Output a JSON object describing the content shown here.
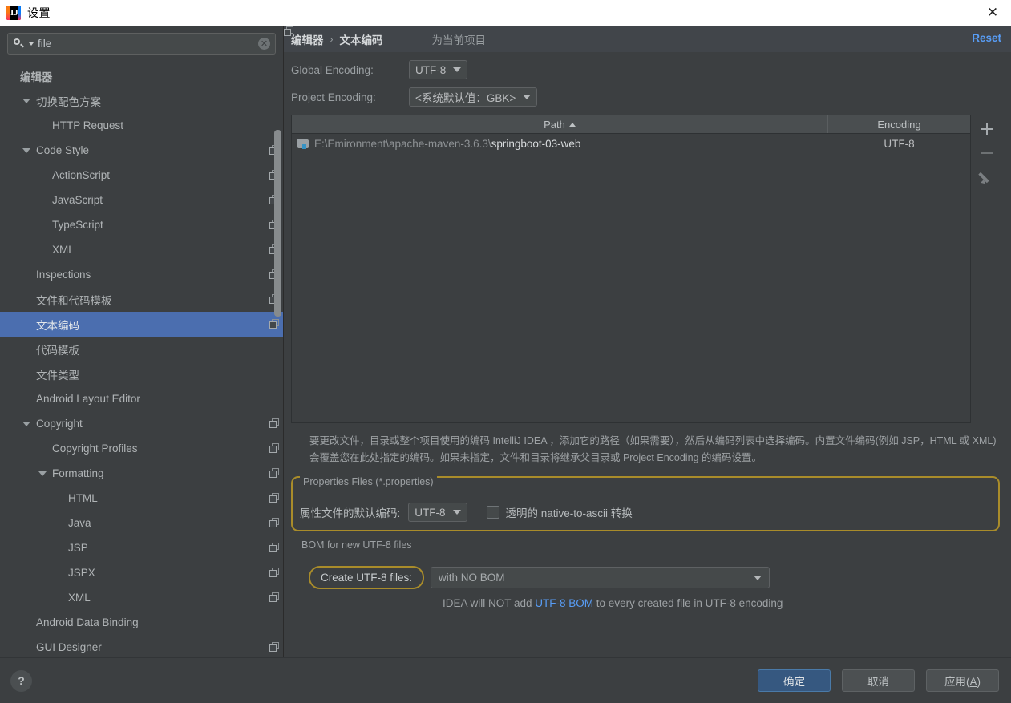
{
  "window": {
    "title": "设置",
    "app_icon": "intellij-idea-icon",
    "close_label": "✕"
  },
  "search": {
    "value": "file",
    "icon": "search-icon",
    "clear_icon": "clear-icon",
    "clear_glyph": "✕"
  },
  "sidebar": {
    "scrollbar": true,
    "items": [
      {
        "label": "编辑器",
        "indent": 0,
        "arrow": "none",
        "copy": false,
        "selected": false,
        "bold": true
      },
      {
        "label": "切换配色方案",
        "indent": 1,
        "arrow": "expanded",
        "copy": false,
        "selected": false
      },
      {
        "label": "HTTP Request",
        "indent": 2,
        "arrow": "none",
        "copy": false,
        "selected": false
      },
      {
        "label": "Code Style",
        "indent": 1,
        "arrow": "expanded",
        "copy": true,
        "selected": false
      },
      {
        "label": "ActionScript",
        "indent": 2,
        "arrow": "none",
        "copy": true,
        "selected": false
      },
      {
        "label": "JavaScript",
        "indent": 2,
        "arrow": "none",
        "copy": true,
        "selected": false
      },
      {
        "label": "TypeScript",
        "indent": 2,
        "arrow": "none",
        "copy": true,
        "selected": false
      },
      {
        "label": "XML",
        "indent": 2,
        "arrow": "none",
        "copy": true,
        "selected": false
      },
      {
        "label": "Inspections",
        "indent": 1,
        "arrow": "none",
        "copy": true,
        "selected": false
      },
      {
        "label": "文件和代码模板",
        "indent": 1,
        "arrow": "none",
        "copy": true,
        "selected": false
      },
      {
        "label": "文本编码",
        "indent": 1,
        "arrow": "none",
        "copy": true,
        "selected": true
      },
      {
        "label": "代码模板",
        "indent": 1,
        "arrow": "none",
        "copy": false,
        "selected": false
      },
      {
        "label": "文件类型",
        "indent": 1,
        "arrow": "none",
        "copy": false,
        "selected": false
      },
      {
        "label": "Android Layout Editor",
        "indent": 1,
        "arrow": "none",
        "copy": false,
        "selected": false
      },
      {
        "label": "Copyright",
        "indent": 1,
        "arrow": "expanded",
        "copy": true,
        "selected": false
      },
      {
        "label": "Copyright Profiles",
        "indent": 2,
        "arrow": "none",
        "copy": true,
        "selected": false
      },
      {
        "label": "Formatting",
        "indent": 2,
        "arrow": "expanded",
        "copy": true,
        "selected": false
      },
      {
        "label": "HTML",
        "indent": 3,
        "arrow": "none",
        "copy": true,
        "selected": false
      },
      {
        "label": "Java",
        "indent": 3,
        "arrow": "none",
        "copy": true,
        "selected": false
      },
      {
        "label": "JSP",
        "indent": 3,
        "arrow": "none",
        "copy": true,
        "selected": false
      },
      {
        "label": "JSPX",
        "indent": 3,
        "arrow": "none",
        "copy": true,
        "selected": false
      },
      {
        "label": "XML",
        "indent": 3,
        "arrow": "none",
        "copy": true,
        "selected": false
      },
      {
        "label": "Android Data Binding",
        "indent": 1,
        "arrow": "none",
        "copy": false,
        "selected": false
      },
      {
        "label": "GUI Designer",
        "indent": 1,
        "arrow": "none",
        "copy": true,
        "selected": false
      }
    ]
  },
  "panel": {
    "breadcrumb": {
      "parent": "编辑器",
      "separator": "›",
      "current": "文本编码"
    },
    "scope_link": "为当前项目",
    "scope_icon": "copy-icon",
    "reset_label": "Reset",
    "global_encoding": {
      "label": "Global Encoding:",
      "value": "UTF-8"
    },
    "project_encoding": {
      "label": "Project Encoding:",
      "value": "<系统默认值：GBK>"
    },
    "table": {
      "columns": [
        "Path",
        "Encoding"
      ],
      "sort_column": "Path",
      "sort_direction": "asc",
      "rows": [
        {
          "path_prefix": "E:\\Emironment\\apache-maven-3.6.3\\",
          "path_name": "springboot-03-web",
          "encoding": "UTF-8"
        }
      ],
      "tools": [
        "add-icon",
        "remove-icon",
        "edit-icon"
      ]
    },
    "description": "要更改文件，目录或整个项目使用的编码 IntelliJ IDEA ，添加它的路径（如果需要），然后从编码列表中选择编码。内置文件编码(例如 JSP，HTML 或 XML)会覆盖您在此处指定的编码。如果未指定，文件和目录将继承父目录或 Project Encoding 的编码设置。",
    "properties_group": {
      "title": "Properties Files (*.properties)",
      "default_encoding_label": "属性文件的默认编码:",
      "default_encoding_value": "UTF-8",
      "transparent_checkbox_label": "透明的 native-to-ascii 转换",
      "transparent_checked": false,
      "highlight_color": "#a98c2a"
    },
    "bom_group": {
      "title": "BOM for new UTF-8 files",
      "create_label": "Create UTF-8 files:",
      "create_value": "with NO BOM",
      "note_prefix": "IDEA will NOT add ",
      "note_link": "UTF-8 BOM",
      "note_suffix": " to every created file in UTF-8 encoding",
      "highlight_color": "#a98c2a"
    }
  },
  "footer": {
    "help_glyph": "?",
    "buttons": [
      {
        "label": "确定",
        "style": "primary"
      },
      {
        "label": "取消",
        "style": "normal"
      },
      {
        "label": "应用(A)",
        "style": "normal",
        "mnemonic": "A"
      }
    ]
  }
}
